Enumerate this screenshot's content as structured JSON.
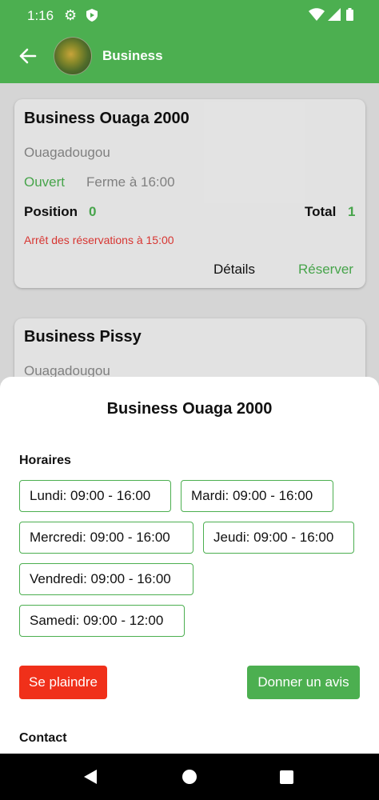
{
  "status": {
    "time": "1:16"
  },
  "header": {
    "title": "Business"
  },
  "cards": [
    {
      "name": "Business Ouaga 2000",
      "city": "Ouagadougou",
      "status": "Ouvert",
      "closes": "Ferme à 16:00",
      "position_label": "Position",
      "position_value": "0",
      "total_label": "Total",
      "total_value": "1",
      "notice": "Arrêt des réservations à 15:00",
      "details_label": "Détails",
      "reserve_label": "Réserver"
    },
    {
      "name": "Business Pissy",
      "city": "Ouagadougou"
    }
  ],
  "sheet": {
    "title": "Business Ouaga 2000",
    "hours_title": "Horaires",
    "hours": [
      "Lundi: 09:00 - 16:00",
      "Mardi: 09:00 - 16:00",
      "Mercredi: 09:00 - 16:00",
      "Jeudi: 09:00 - 16:00",
      "Vendredi: 09:00 - 16:00",
      "Samedi: 09:00 - 12:00"
    ],
    "complain_label": "Se plaindre",
    "review_label": "Donner un avis",
    "contact_title": "Contact"
  },
  "colors": {
    "primary": "#4caf50",
    "danger": "#f0301a",
    "notice": "#e53935"
  }
}
